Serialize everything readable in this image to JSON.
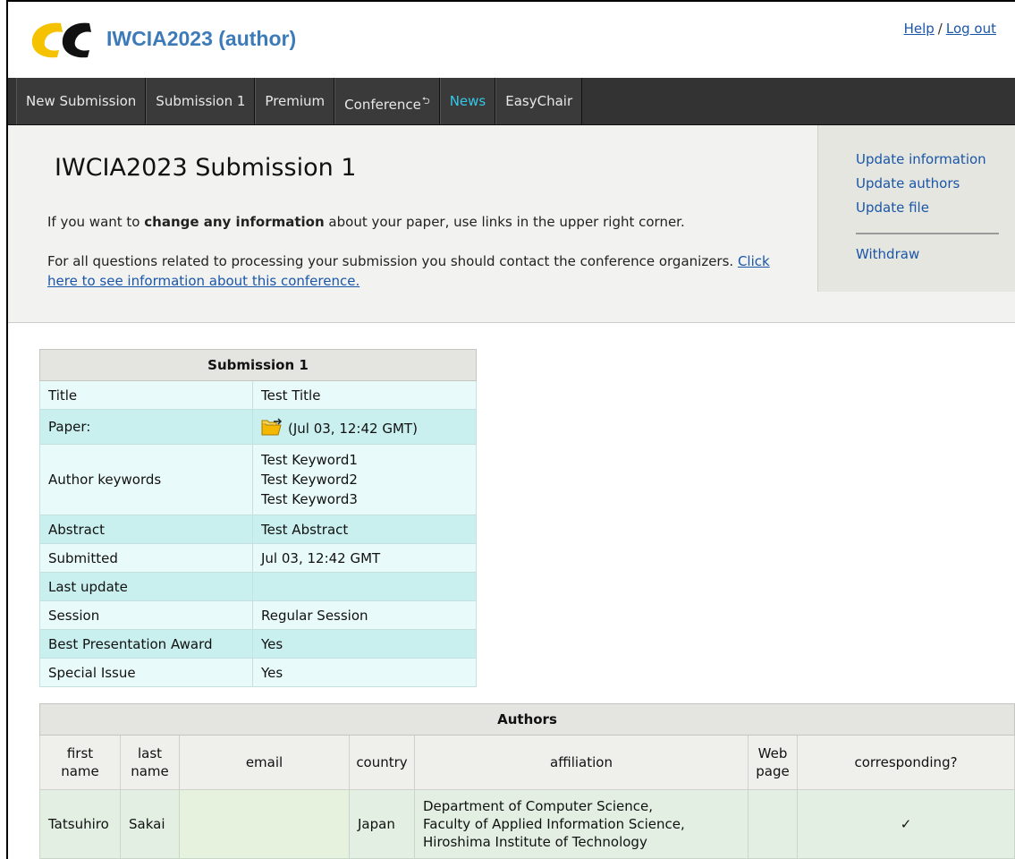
{
  "header": {
    "title": "IWCIA2023 (author)",
    "logo": "easychair-ec-logo",
    "help_label": "Help",
    "separator": "/",
    "logout_label": "Log out"
  },
  "menu": {
    "items": [
      {
        "label": "New Submission"
      },
      {
        "label": "Submission 1"
      },
      {
        "label": "Premium"
      },
      {
        "label": "Conference",
        "icon": "external-return-icon"
      },
      {
        "label": "News",
        "color": "#35c7e8"
      },
      {
        "label": "EasyChair"
      }
    ]
  },
  "page": {
    "title": "IWCIA2023 Submission 1",
    "para1_pre": "If you want to ",
    "para1_bold": "change any information",
    "para1_post": " about your paper, use links in the upper right corner.",
    "para2_text": "For all questions related to processing your submission you should contact the conference organizers. ",
    "para2_link": "Click here to see information about this conference."
  },
  "side_panel": {
    "update_information": "Update information",
    "update_authors": "Update authors",
    "update_file": "Update file",
    "withdraw": "Withdraw"
  },
  "submission": {
    "caption": "Submission 1",
    "title_label": "Title",
    "title_value": "Test Title",
    "paper_label": "Paper:",
    "paper_value": "(Jul 03, 12:42 GMT)",
    "paper_icon": "folder-download-icon",
    "keywords_label": "Author keywords",
    "keywords": [
      "Test Keyword1",
      "Test Keyword2",
      "Test Keyword3"
    ],
    "abstract_label": "Abstract",
    "abstract_value": "Test Abstract",
    "submitted_label": "Submitted",
    "submitted_value": "Jul 03, 12:42 GMT",
    "last_update_label": "Last update",
    "last_update_value": "",
    "session_label": "Session",
    "session_value": "Regular Session",
    "award_label": "Best Presentation Award",
    "award_value": "Yes",
    "special_label": "Special Issue",
    "special_value": "Yes"
  },
  "authors": {
    "caption": "Authors",
    "columns": {
      "first_a": "first",
      "first_b": "name",
      "last_a": "last",
      "last_b": "name",
      "email": "email",
      "country": "country",
      "affiliation": "affiliation",
      "web_a": "Web",
      "web_b": "page",
      "corresponding": "corresponding?"
    },
    "rows": [
      {
        "first": "Tatsuhiro",
        "last": "Sakai",
        "email": "",
        "country": "Japan",
        "affiliation_lines": [
          "Department of Computer Science,",
          "Faculty of Applied Information Science,",
          "Hiroshima Institute of Technology"
        ],
        "web": "",
        "corresponding": "✓"
      }
    ]
  },
  "colors": {
    "menu_bg": "#333333",
    "news": "#35c7e8",
    "title": "#3d7ab8",
    "link": "#1a56a8",
    "table_odd": "#e8fafa",
    "table_even": "#c9f0ef"
  }
}
